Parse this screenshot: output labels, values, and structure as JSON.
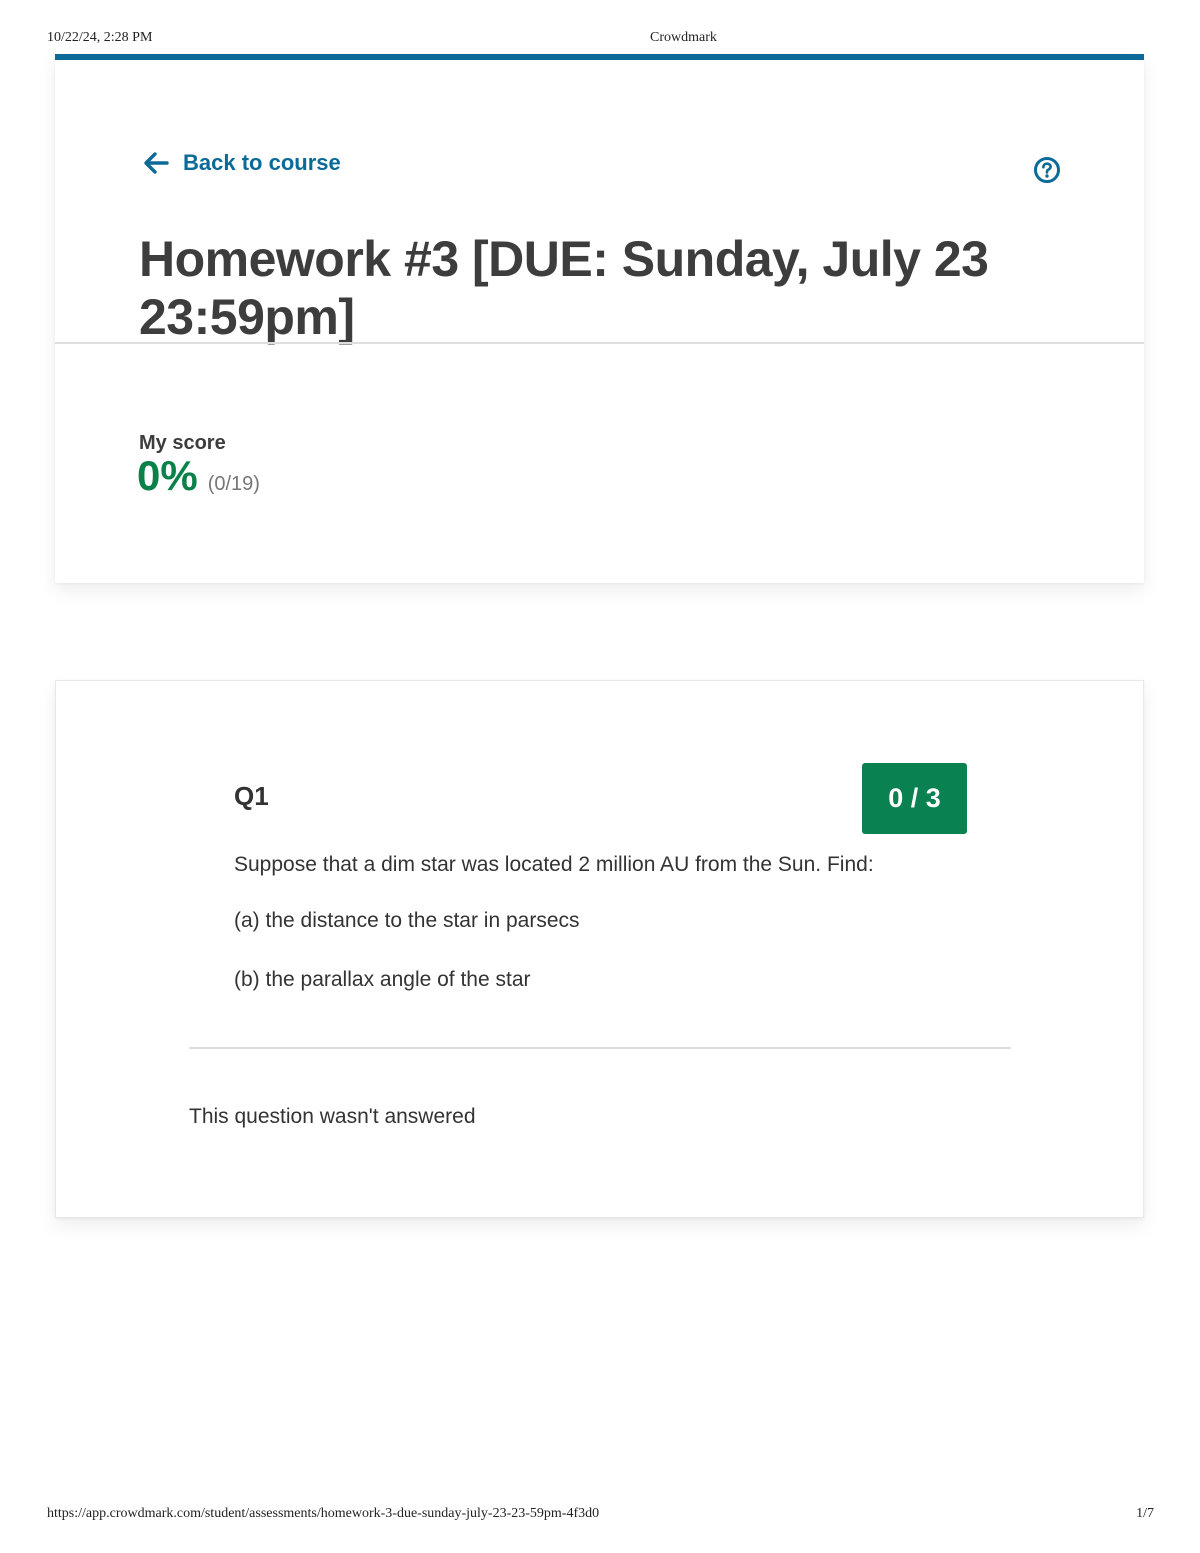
{
  "print_header": {
    "datetime": "10/22/24, 2:28 PM",
    "site": "Crowdmark"
  },
  "print_footer": {
    "url": "https://app.crowdmark.com/student/assessments/homework-3-due-sunday-july-23-23-59pm-4f3d0",
    "page": "1/7"
  },
  "header": {
    "back_label": "Back to course",
    "title": "Homework #3 [DUE: Sunday, July 23 23:59pm]"
  },
  "score": {
    "label": "My score",
    "percent": "0%",
    "fraction": "(0/19)"
  },
  "question": {
    "number": "Q1",
    "score_badge": "0 / 3",
    "prompt_lines": [
      "Suppose that a dim star was located 2 million AU from the Sun. Find:",
      "(a) the distance to the star in parsecs",
      "(b) the parallax angle of the star"
    ],
    "status": "This question wasn't answered"
  },
  "icons": {
    "back": "arrow-left-icon",
    "help": "help-circle-icon"
  },
  "colors": {
    "accent_blue": "#0b6a98",
    "score_green": "#0a8149",
    "badge_green": "#0a8150"
  }
}
